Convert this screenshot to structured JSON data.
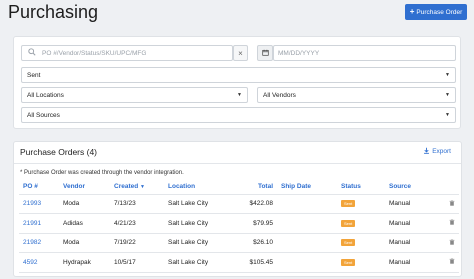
{
  "header": {
    "title": "Purchasing",
    "new_po_label": "Purchase Order"
  },
  "filters": {
    "search_placeholder": "PO #/Vendor/Status/SKU/UPC/MFG",
    "clear_label": "×",
    "date_placeholder": "MM/DD/YYYY",
    "status_value": "Sent",
    "locations_value": "All Locations",
    "vendors_value": "All Vendors",
    "sources_value": "All Sources"
  },
  "orders": {
    "title": "Purchase Orders (4)",
    "export_label": "Export",
    "note": "* Purchase Order was created through the vendor integration.",
    "columns": [
      "PO #",
      "Vendor",
      "Created",
      "Location",
      "Total",
      "Ship Date",
      "Status",
      "Source"
    ],
    "rows": [
      {
        "po": "21993",
        "vendor": "Moda",
        "created": "7/13/23",
        "location": "Salt Lake City",
        "total": "$422.08",
        "ship_date": "",
        "status": "Sent",
        "source": "Manual"
      },
      {
        "po": "21991",
        "vendor": "Adidas",
        "created": "4/21/23",
        "location": "Salt Lake City",
        "total": "$79.95",
        "ship_date": "",
        "status": "Sent",
        "source": "Manual"
      },
      {
        "po": "21982",
        "vendor": "Moda",
        "created": "7/19/22",
        "location": "Salt Lake City",
        "total": "$26.10",
        "ship_date": "",
        "status": "Sent",
        "source": "Manual"
      },
      {
        "po": "4592",
        "vendor": "Hydrapak",
        "created": "10/5/17",
        "location": "Salt Lake City",
        "total": "$105.45",
        "ship_date": "",
        "status": "Sent",
        "source": "Manual"
      }
    ]
  },
  "colors": {
    "accent": "#2f6fd0",
    "status_sent": "#f2a43a"
  }
}
